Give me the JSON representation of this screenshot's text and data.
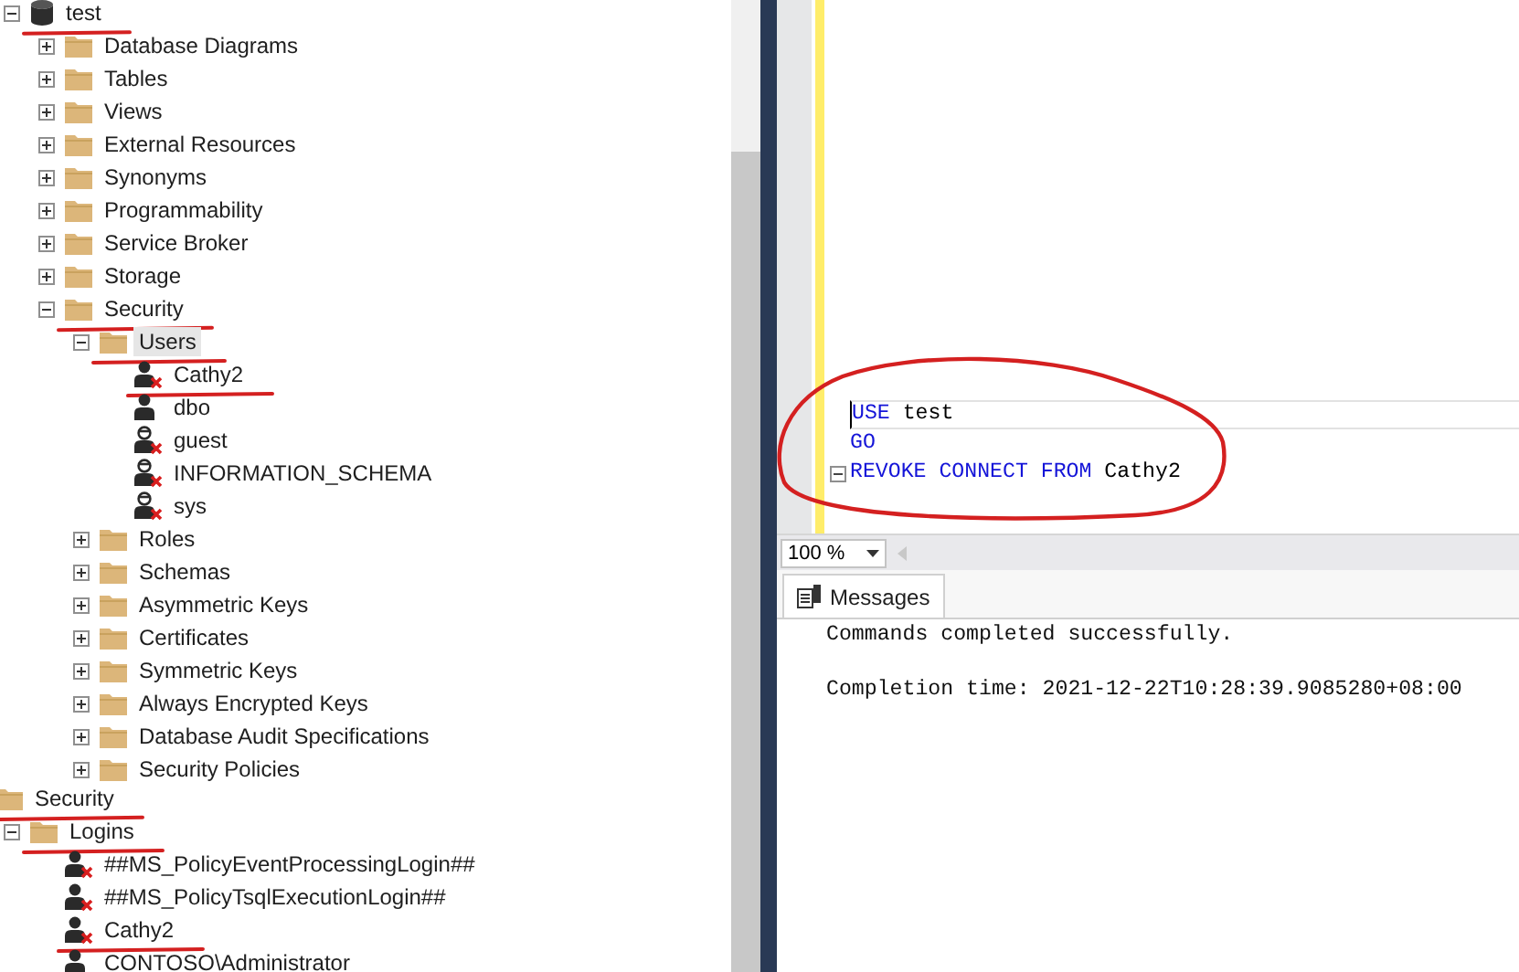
{
  "database_tree": [
    {
      "label": "test",
      "kind": "database",
      "expanded": true,
      "selected": false,
      "underlined": true,
      "children": [
        {
          "label": "Database Diagrams",
          "kind": "folder",
          "expanded": false,
          "selected": false,
          "underlined": false
        },
        {
          "label": "Tables",
          "kind": "folder",
          "expanded": false,
          "selected": false,
          "underlined": false
        },
        {
          "label": "Views",
          "kind": "folder",
          "expanded": false,
          "selected": false,
          "underlined": false
        },
        {
          "label": "External Resources",
          "kind": "folder",
          "expanded": false,
          "selected": false,
          "underlined": false
        },
        {
          "label": "Synonyms",
          "kind": "folder",
          "expanded": false,
          "selected": false,
          "underlined": false
        },
        {
          "label": "Programmability",
          "kind": "folder",
          "expanded": false,
          "selected": false,
          "underlined": false
        },
        {
          "label": "Service Broker",
          "kind": "folder",
          "expanded": false,
          "selected": false,
          "underlined": false
        },
        {
          "label": "Storage",
          "kind": "folder",
          "expanded": false,
          "selected": false,
          "underlined": false
        },
        {
          "label": "Security",
          "kind": "folder",
          "expanded": true,
          "selected": false,
          "underlined": true,
          "children": [
            {
              "label": "Users",
              "kind": "folder",
              "expanded": true,
              "selected": true,
              "underlined": true,
              "children": [
                {
                  "label": "Cathy2",
                  "kind": "user",
                  "disabled": true,
                  "selected": false,
                  "underlined": true
                },
                {
                  "label": "dbo",
                  "kind": "user",
                  "disabled": false,
                  "selected": false,
                  "underlined": false
                },
                {
                  "label": "guest",
                  "kind": "system_user",
                  "disabled": true,
                  "selected": false,
                  "underlined": false
                },
                {
                  "label": "INFORMATION_SCHEMA",
                  "kind": "system_user",
                  "disabled": true,
                  "selected": false,
                  "underlined": false
                },
                {
                  "label": "sys",
                  "kind": "system_user",
                  "disabled": true,
                  "selected": false,
                  "underlined": false
                }
              ]
            },
            {
              "label": "Roles",
              "kind": "folder",
              "expanded": false,
              "selected": false,
              "underlined": false
            },
            {
              "label": "Schemas",
              "kind": "folder",
              "expanded": false,
              "selected": false,
              "underlined": false
            },
            {
              "label": "Asymmetric Keys",
              "kind": "folder",
              "expanded": false,
              "selected": false,
              "underlined": false
            },
            {
              "label": "Certificates",
              "kind": "folder",
              "expanded": false,
              "selected": false,
              "underlined": false
            },
            {
              "label": "Symmetric Keys",
              "kind": "folder",
              "expanded": false,
              "selected": false,
              "underlined": false
            },
            {
              "label": "Always Encrypted Keys",
              "kind": "folder",
              "expanded": false,
              "selected": false,
              "underlined": false
            },
            {
              "label": "Database Audit Specifications",
              "kind": "folder",
              "expanded": false,
              "selected": false,
              "underlined": false
            },
            {
              "label": "Security Policies",
              "kind": "folder",
              "expanded": false,
              "selected": false,
              "underlined": false
            }
          ]
        }
      ]
    }
  ],
  "server_tree": [
    {
      "label": "Security",
      "kind": "folder",
      "selected": false,
      "underlined": true,
      "children": [
        {
          "label": "Logins",
          "kind": "folder",
          "expanded": true,
          "selected": false,
          "underlined": true,
          "children": [
            {
              "label": "##MS_PolicyEventProcessingLogin##",
              "kind": "user",
              "disabled": true,
              "selected": false,
              "underlined": false
            },
            {
              "label": "##MS_PolicyTsqlExecutionLogin##",
              "kind": "user",
              "disabled": true,
              "selected": false,
              "underlined": false
            },
            {
              "label": "Cathy2",
              "kind": "user",
              "disabled": true,
              "selected": false,
              "underlined": true
            },
            {
              "label": "CONTOSO\\Administrator",
              "kind": "user",
              "disabled": false,
              "selected": false,
              "underlined": false
            }
          ]
        }
      ]
    }
  ],
  "editor": {
    "circled": true,
    "lines": [
      {
        "current": true,
        "foldable": false,
        "tokens": [
          {
            "text": "USE",
            "kind": "keyword"
          },
          {
            "text": " test",
            "kind": "plain"
          }
        ]
      },
      {
        "current": false,
        "foldable": false,
        "tokens": [
          {
            "text": "GO",
            "kind": "keyword"
          }
        ]
      },
      {
        "current": false,
        "foldable": true,
        "tokens": [
          {
            "text": "REVOKE CONNECT FROM",
            "kind": "keyword"
          },
          {
            "text": " Cathy2",
            "kind": "plain"
          }
        ]
      }
    ]
  },
  "zoom_box": {
    "value": "100 %"
  },
  "results": {
    "tabs": [
      {
        "label": "Messages",
        "selected": true
      }
    ],
    "messages": [
      "Commands completed successfully.",
      "Completion time: 2021-12-22T10:28:39.9085280+08:00"
    ]
  }
}
